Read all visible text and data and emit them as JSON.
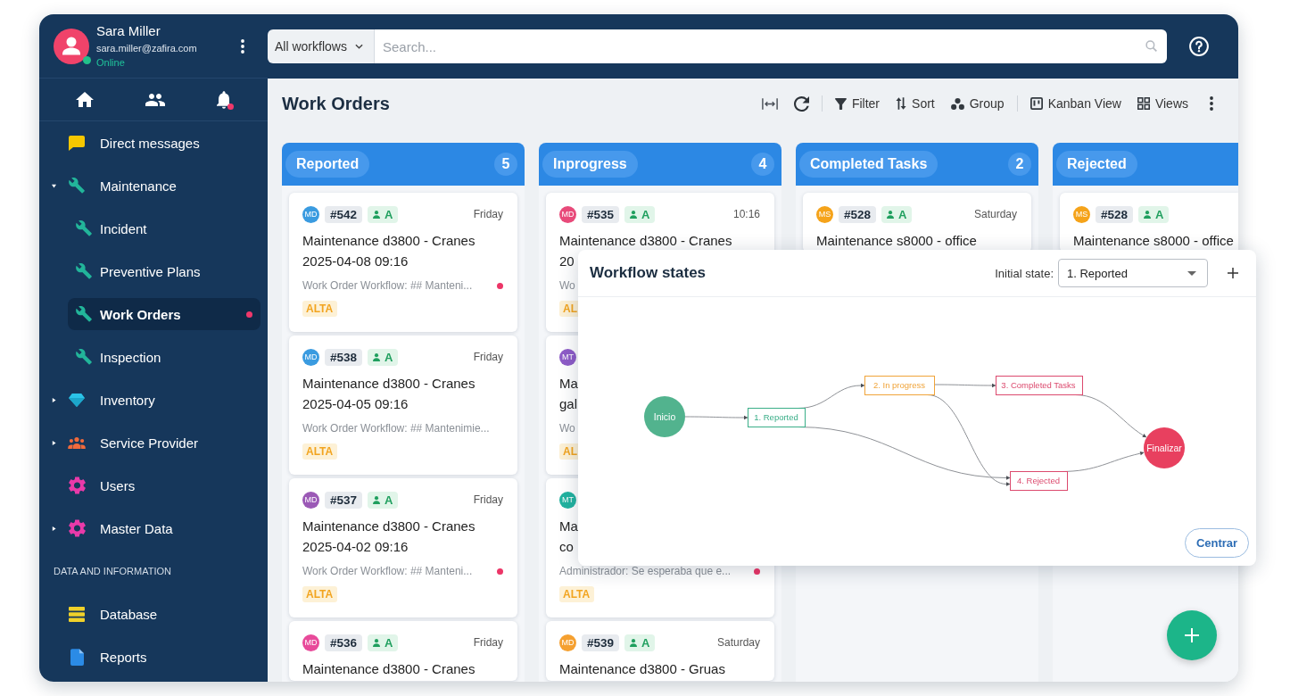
{
  "sidebar": {
    "user": {
      "name": "Sara Miller",
      "email": "sara.miller@zafira.com",
      "status": "Online",
      "online": true
    },
    "notifications_unread": true,
    "sections": [
      {
        "items": [
          {
            "label": "Direct messages",
            "kind": "link",
            "selected": false,
            "unread": false
          },
          {
            "label": "Maintenance",
            "kind": "group",
            "expanded": true,
            "selected": false,
            "unread": false,
            "children": [
              {
                "label": "Incident",
                "selected": false,
                "unread": false
              },
              {
                "label": "Preventive Plans",
                "selected": false,
                "unread": false
              },
              {
                "label": "Work Orders",
                "selected": true,
                "unread": true
              },
              {
                "label": "Inspection",
                "selected": false,
                "unread": false
              }
            ]
          },
          {
            "label": "Inventory",
            "kind": "group",
            "expanded": false,
            "selected": false,
            "unread": false
          },
          {
            "label": "Service Provider",
            "kind": "group",
            "expanded": false,
            "selected": false,
            "unread": false
          },
          {
            "label": "Users",
            "kind": "link",
            "selected": false,
            "unread": false
          },
          {
            "label": "Master Data",
            "kind": "group",
            "expanded": false,
            "selected": false,
            "unread": false
          }
        ]
      },
      {
        "title": "DATA AND INFORMATION",
        "items": [
          {
            "label": "Database",
            "kind": "link",
            "selected": false,
            "unread": false
          },
          {
            "label": "Reports",
            "kind": "link",
            "selected": false,
            "unread": false
          }
        ]
      }
    ]
  },
  "topbar": {
    "workflow_filter": "All workflows",
    "search": {
      "placeholder": "Search..."
    }
  },
  "toolbar": {
    "title": "Work Orders",
    "action_groups": [
      {
        "actions": [
          {
            "label": "Filter"
          },
          {
            "label": "Sort"
          },
          {
            "label": "Group"
          }
        ]
      },
      {
        "actions": [
          {
            "label": "Kanban View"
          },
          {
            "label": "Views"
          }
        ]
      }
    ]
  },
  "board": {
    "columns": [
      {
        "title": "Reported",
        "count": "5",
        "cards": [
          {
            "avatar": {
              "initials": "MD",
              "color": "#3a9be0"
            },
            "id": "#542",
            "assignee": "A",
            "date": "Friday",
            "title_lines": [
              "Maintenance d3800 - Cranes",
              "2025-04-08 09:16"
            ],
            "description": "Work Order Workflow: ## Manteni...",
            "unread": true,
            "priority": "ALTA"
          },
          {
            "avatar": {
              "initials": "MD",
              "color": "#3a9be0"
            },
            "id": "#538",
            "assignee": "A",
            "date": "Friday",
            "title_lines": [
              "Maintenance d3800 - Cranes",
              "2025-04-05 09:16"
            ],
            "description": "Work Order Workflow: ## Mantenimie...",
            "unread": false,
            "priority": "ALTA"
          },
          {
            "avatar": {
              "initials": "MD",
              "color": "#9b59b6"
            },
            "id": "#537",
            "assignee": "A",
            "date": "Friday",
            "title_lines": [
              "Maintenance d3800 - Cranes",
              "2025-04-02 09:16"
            ],
            "description": "Work Order Workflow: ## Manteni...",
            "unread": true,
            "priority": "ALTA"
          },
          {
            "avatar": {
              "initials": "MD",
              "color": "#e84a9a"
            },
            "id": "#536",
            "assignee": "A",
            "date": "Friday",
            "title_lines": [
              "Maintenance d3800 - Cranes"
            ]
          }
        ]
      },
      {
        "title": "Inprogress",
        "count": "4",
        "cards": [
          {
            "avatar": {
              "initials": "MD",
              "color": "#e84a7a"
            },
            "id": "#535",
            "assignee": "A",
            "date": "10:16",
            "title_lines": [
              "Maintenance d3800 - Cranes",
              "20"
            ],
            "description": "Wo",
            "unread": false,
            "priority": "AL"
          },
          {
            "avatar": {
              "initials": "MT",
              "color": "#8e5cc8"
            },
            "title_lines": [
              "Ma",
              "gal"
            ],
            "description": "Wo",
            "unread": false,
            "priority": "AL"
          },
          {
            "avatar": {
              "initials": "MT",
              "color": "#22b3a0"
            },
            "title_lines": [
              "Ma",
              "co"
            ],
            "description": "Administrador: Se esperaba que e...",
            "unread": true,
            "priority": "ALTA"
          },
          {
            "avatar": {
              "initials": "MD",
              "color": "#f5a030"
            },
            "id": "#539",
            "assignee": "A",
            "date": "Saturday",
            "title_lines": [
              "Maintenance d3800 - Gruas"
            ]
          }
        ]
      },
      {
        "title": "Completed Tasks",
        "count": "2",
        "cards": [
          {
            "avatar": {
              "initials": "MS",
              "color": "#f5a31a"
            },
            "id": "#528",
            "assignee": "A",
            "date": "Saturday",
            "title_lines": [
              "Maintenance s8000 - office"
            ]
          }
        ]
      },
      {
        "title": "Rejected",
        "cards": [
          {
            "avatar": {
              "initials": "MS",
              "color": "#f5a31a"
            },
            "id": "#528",
            "assignee": "A",
            "title_lines": [
              "Maintenance s8000 - office"
            ]
          }
        ]
      }
    ]
  },
  "workflow_panel": {
    "title": "Workflow states",
    "initial_state_label": "Initial state:",
    "initial_state": "1. Reported",
    "nodes": [
      {
        "label": "Inicio",
        "kind": "terminal",
        "color": "#52b38e"
      },
      {
        "label": "1. Reported",
        "kind": "state",
        "color": "#3aae88"
      },
      {
        "label": "2. In progress",
        "kind": "state",
        "color": "#f0a43a"
      },
      {
        "label": "3. Completed Tasks",
        "kind": "state",
        "color": "#dc4a6e"
      },
      {
        "label": "4. Rejected",
        "kind": "state",
        "color": "#dc4a6e"
      },
      {
        "label": "Finalizar",
        "kind": "terminal",
        "color": "#e8405f"
      }
    ],
    "center_button": "Centrar"
  }
}
